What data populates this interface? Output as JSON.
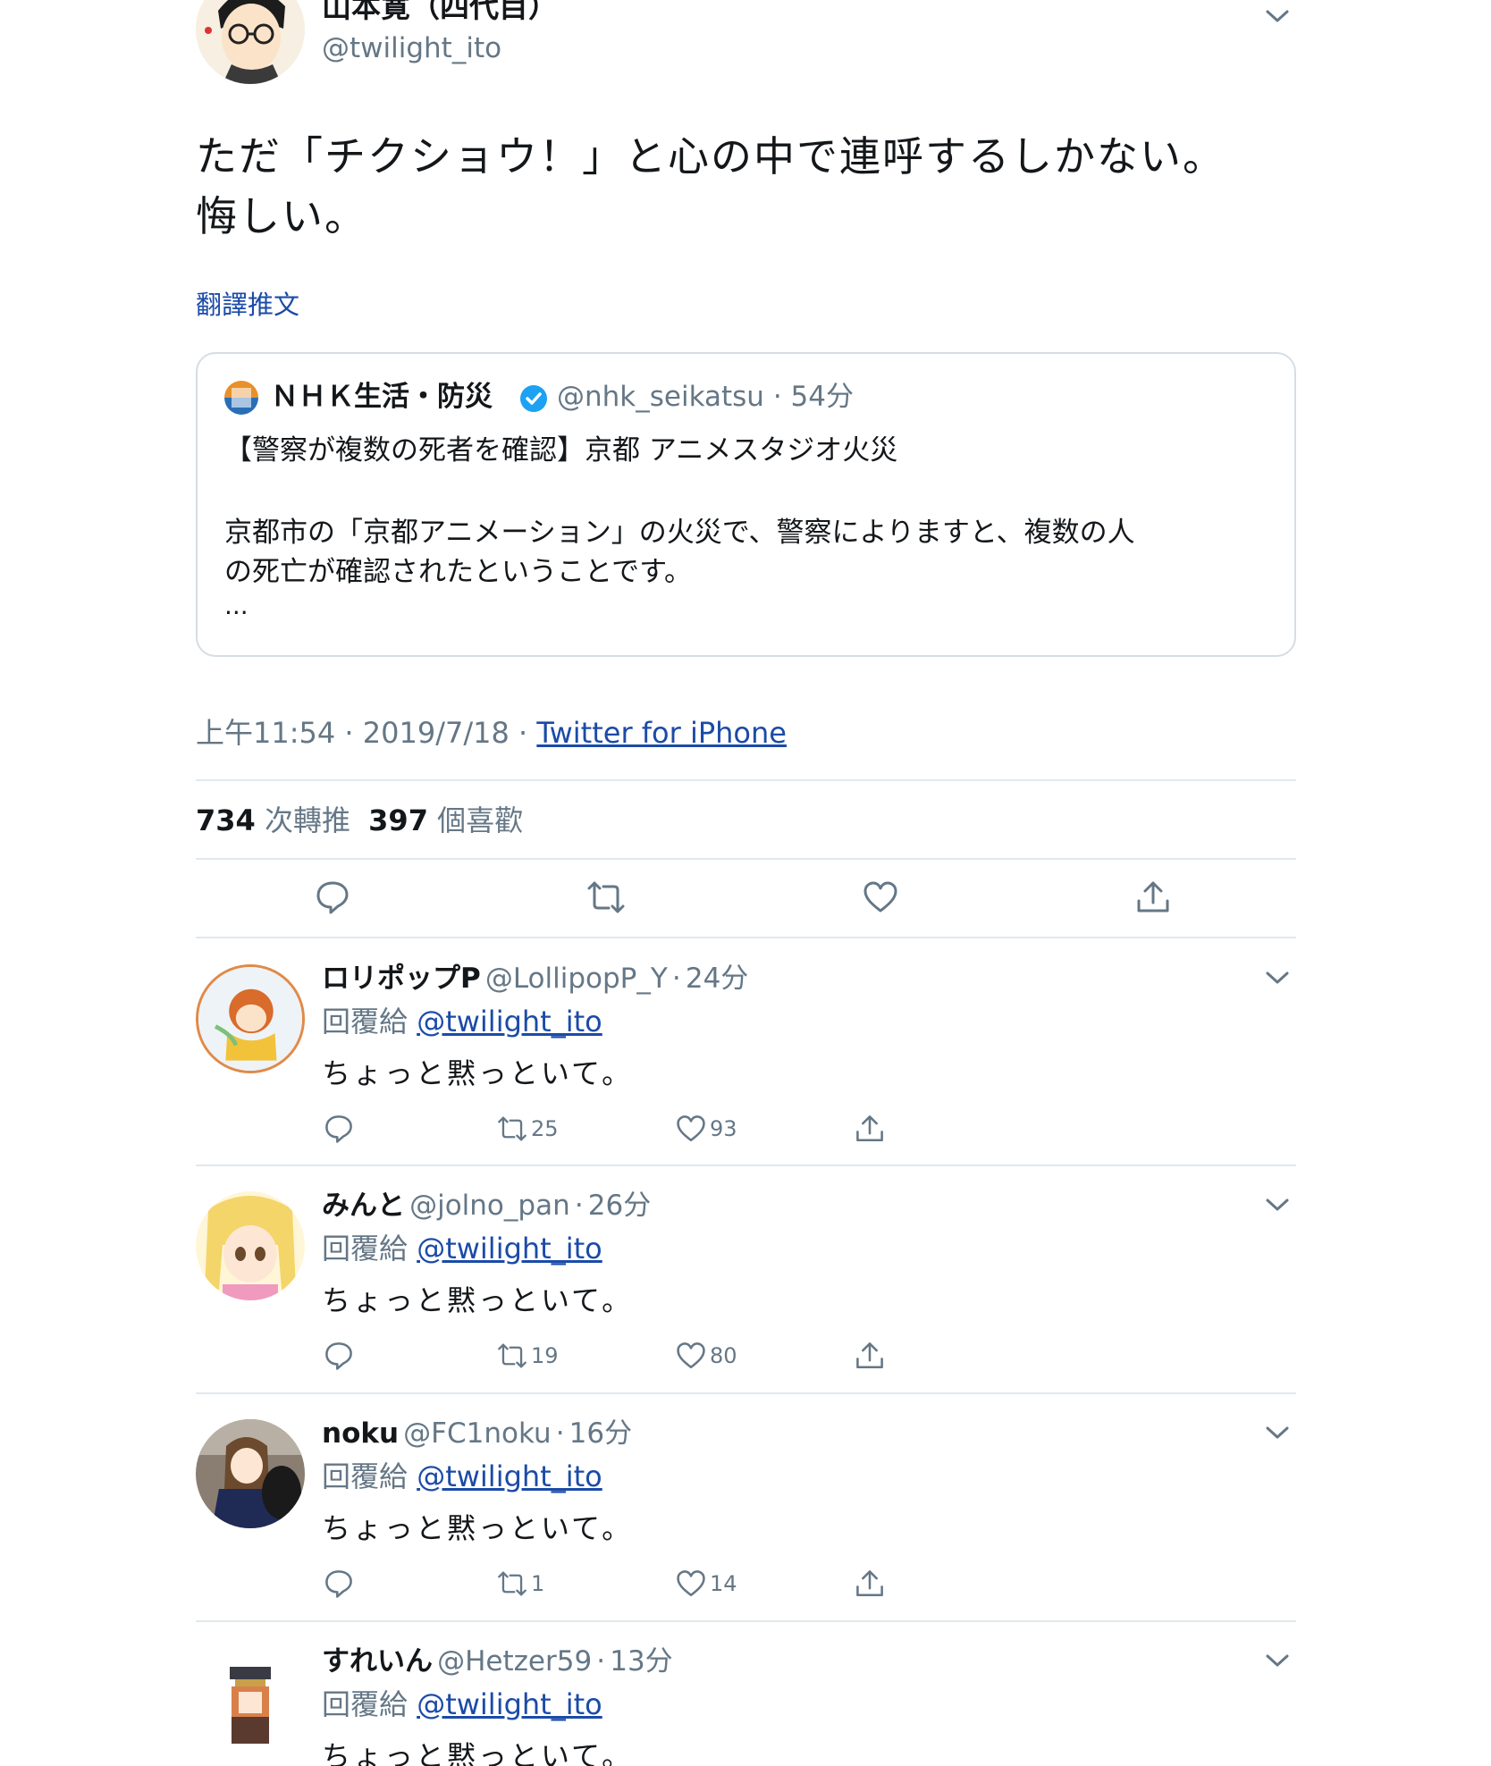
{
  "tweet": {
    "display_name": "山本寛（四代目）",
    "handle": "@twilight_ito",
    "text_line1": "ただ「チクショウ！」と心の中で連呼するしかない。",
    "text_line2": "悔しい。",
    "translate_label": "翻譯推文",
    "quote": {
      "name": "ＮＨＫ生活・防災",
      "handle": "@nhk_seikatsu",
      "time": "54分",
      "headline": "【警察が複数の死者を確認】京都 アニメスタジオ火災",
      "body_line1": "京都市の「京都アニメーション」の火災で、警察によりますと、複数の人",
      "body_line2": "の死亡が確認されたということです。",
      "ellipsis": "..."
    },
    "time": "上午11:54",
    "date": "2019/7/18",
    "source": "Twitter for iPhone",
    "retweets_count": "734",
    "retweets_label": "次轉推",
    "likes_count": "397",
    "likes_label": "個喜歡"
  },
  "replies": [
    {
      "name": "ロリポップP",
      "handle": "@LollipopP_Y",
      "time": "24分",
      "reply_to_label": "回覆給",
      "reply_to": "@twilight_ito",
      "text": "ちょっと黙っといて。",
      "retweets": "25",
      "likes": "93"
    },
    {
      "name": "みんと",
      "handle": "@jolno_pan",
      "time": "26分",
      "reply_to_label": "回覆給",
      "reply_to": "@twilight_ito",
      "text": "ちょっと黙っといて。",
      "retweets": "19",
      "likes": "80"
    },
    {
      "name": "noku",
      "handle": "@FC1noku",
      "time": "16分",
      "reply_to_label": "回覆給",
      "reply_to": "@twilight_ito",
      "text": "ちょっと黙っといて。",
      "retweets": "1",
      "likes": "14"
    },
    {
      "name": "すれいん",
      "handle": "@Hetzer59",
      "time": "13分",
      "reply_to_label": "回覆給",
      "reply_to": "@twilight_ito",
      "text": "ちょっと黙っといて。",
      "retweets": "",
      "likes": ""
    }
  ],
  "separator": "·",
  "colors": {
    "link": "#1b4ba8",
    "verified": "#1da1f2",
    "muted": "#657786",
    "divider": "#e1e8ed"
  },
  "icons": [
    "chevron-down-icon",
    "reply-icon",
    "retweet-icon",
    "like-icon",
    "share-icon",
    "verified-badge-icon"
  ]
}
